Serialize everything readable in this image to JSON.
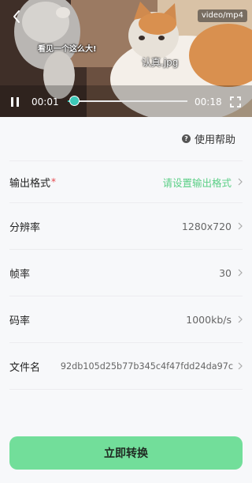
{
  "video": {
    "format_tag": "video/mp4",
    "caption_top": "看见一个这么大!",
    "caption_center": "认真.jpg",
    "current_time": "00:01",
    "total_time": "00:18",
    "progress": 0.055
  },
  "help": {
    "label": "使用帮助",
    "icon": "question-circle-icon"
  },
  "settings": [
    {
      "label": "输出格式",
      "required": true,
      "value": "请设置输出格式",
      "accent": true
    },
    {
      "label": "分辨率",
      "required": false,
      "value": "1280x720",
      "accent": false
    },
    {
      "label": "帧率",
      "required": false,
      "value": "30",
      "accent": false
    },
    {
      "label": "码率",
      "required": false,
      "value": "1000kb/s",
      "accent": false
    },
    {
      "label": "文件名",
      "required": false,
      "value": "92db105d25b77b345c4f47fdd24da97c",
      "accent": false
    }
  ],
  "required_mark": "*",
  "convert_button": {
    "label": "立即转换"
  },
  "colors": {
    "accent": "#5bcf86",
    "button": "#72de9a",
    "progress": "#3cc8b8",
    "required": "#e5484d"
  }
}
